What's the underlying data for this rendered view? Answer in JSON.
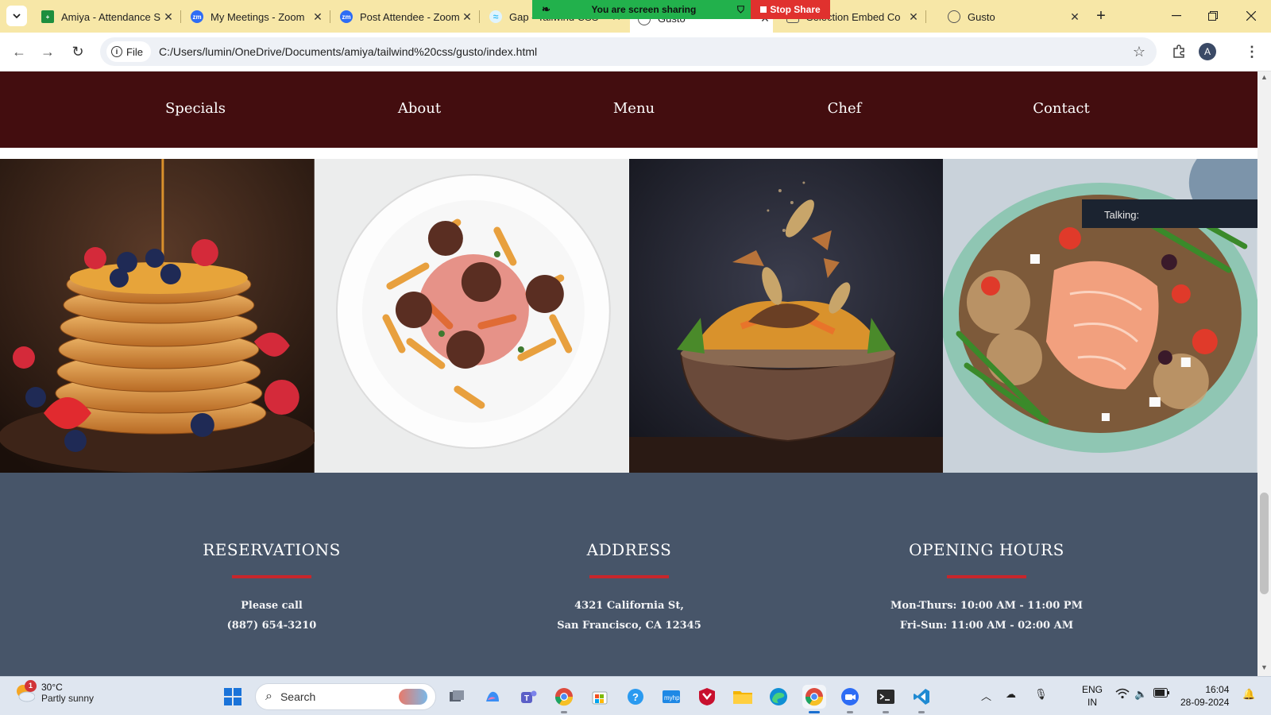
{
  "browser": {
    "tabs": [
      {
        "label": "Amiya - Attendance S",
        "favicon": "sheets-icon",
        "color": "#1e8e3e"
      },
      {
        "label": "My Meetings - Zoom",
        "favicon": "zoom-icon",
        "color": "#2d6cf5"
      },
      {
        "label": "Post Attendee - Zoom",
        "favicon": "zoom-icon",
        "color": "#2d6cf5"
      },
      {
        "label": "Gap - Tailwind CSS",
        "favicon": "tailwind-icon",
        "color": "#38bdf8"
      },
      {
        "label": "Gusto",
        "favicon": "globe-icon",
        "color": "#555555"
      },
      {
        "label": "Selection Embed Co",
        "favicon": "page-icon",
        "color": "#555555"
      },
      {
        "label": "Gusto",
        "favicon": "globe-icon",
        "color": "#555555"
      }
    ],
    "share_banner": "You are screen sharing",
    "stop_share": "Stop Share",
    "address_chip": "File",
    "url": "C:/Users/lumin/OneDrive/Documents/amiya/tailwind%20css/gusto/index.html",
    "avatar_letter": "A"
  },
  "site": {
    "nav": [
      "Specials",
      "About",
      "Menu",
      "Chef",
      "Contact"
    ],
    "gallery_names": [
      "pancakes-image",
      "pasta-meatballs-image",
      "flying-bowl-image",
      "salmon-salad-image"
    ],
    "info": [
      {
        "title": "RESERVATIONS",
        "line1": "Please call",
        "line2": "(887) 654-3210"
      },
      {
        "title": "ADDRESS",
        "line1": "4321 California St,",
        "line2": "San Francisco, CA 12345"
      },
      {
        "title": "OPENING HOURS",
        "line1": "Mon-Thurs: 10:00 AM - 11:00 PM",
        "line2": "Fri-Sun: 11:00 AM - 02:00 AM"
      }
    ],
    "colors": {
      "nav_bg": "#430d0f",
      "info_bg": "#475569",
      "accent": "#c8262b"
    }
  },
  "overlay": {
    "talking": "Talking:"
  },
  "taskbar": {
    "temp": "30°C",
    "weather": "Partly sunny",
    "weather_badge": "1",
    "search": "Search",
    "lang1": "ENG",
    "lang2": "IN",
    "time": "16:04",
    "date": "28-09-2024"
  }
}
